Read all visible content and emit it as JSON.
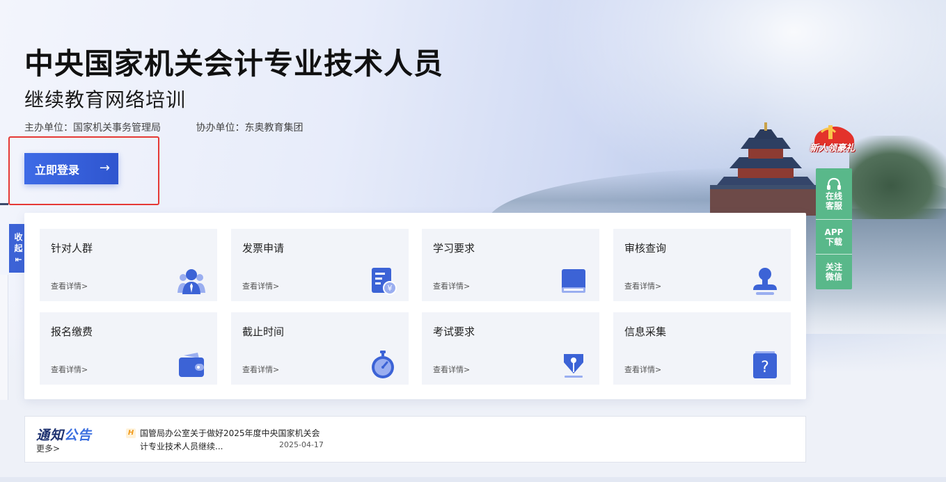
{
  "hero": {
    "title": "中央国家机关会计专业技术人员",
    "subtitle": "继续教育网络培训",
    "host": "主办单位：国家机关事务管理局",
    "co_host": "协办单位：东奥教育集团",
    "login_label": "立即登录",
    "login_arrow": "→"
  },
  "collapse": {
    "line1": "收",
    "line2": "起",
    "icon": "⇤"
  },
  "cards": [
    {
      "title": "针对人群",
      "link": "查看详情>",
      "icon": "users-icon"
    },
    {
      "title": "发票申请",
      "link": "查看详情>",
      "icon": "invoice-icon"
    },
    {
      "title": "学习要求",
      "link": "查看详情>",
      "icon": "book-icon"
    },
    {
      "title": "审核查询",
      "link": "查看详情>",
      "icon": "stamp-icon"
    },
    {
      "title": "报名缴费",
      "link": "查看详情>",
      "icon": "wallet-icon"
    },
    {
      "title": "截止时间",
      "link": "查看详情>",
      "icon": "stopwatch-icon"
    },
    {
      "title": "考试要求",
      "link": "查看详情>",
      "icon": "pen-nib-icon"
    },
    {
      "title": "信息采集",
      "link": "查看详情>",
      "icon": "question-icon"
    }
  ],
  "notice": {
    "title_a": "通知",
    "title_b": "公告",
    "more": "更多>",
    "hot_badge": "H",
    "item_text": "国管局办公室关于做好2025年度中央国家机关会计专业技术人员继续...",
    "item_date": "2025-04-17"
  },
  "float_bar": {
    "gift": "新人领豪礼",
    "service_line1": "在线",
    "service_line2": "客服",
    "app_line1": "APP",
    "app_line2": "下载",
    "wechat_line1": "关注",
    "wechat_line2": "微信"
  },
  "colors": {
    "accent": "#3c63d6",
    "float_green": "#59b88a",
    "highlight_red": "#e53935"
  }
}
